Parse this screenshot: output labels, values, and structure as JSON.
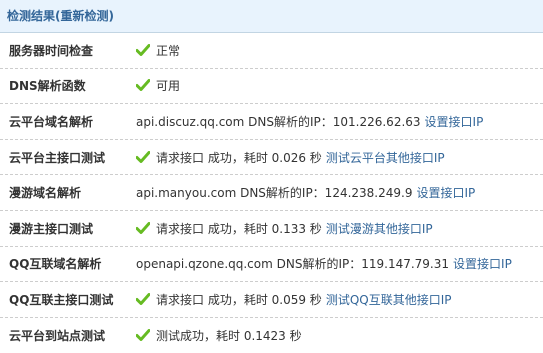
{
  "header": {
    "title": "检测结果(重新检测)"
  },
  "rows": [
    {
      "label": "服务器时间检查",
      "status": "正常"
    },
    {
      "label": "DNS解析函数",
      "status": "可用"
    },
    {
      "label": "云平台域名解析",
      "value": "api.discuz.qq.com DNS解析的IP：101.226.62.63",
      "link": "设置接口IP"
    },
    {
      "label": "云平台主接口测试",
      "status": "请求接口 成功，耗时 0.026 秒",
      "link": "测试云平台其他接口IP"
    },
    {
      "label": "漫游域名解析",
      "value": "api.manyou.com DNS解析的IP：124.238.249.9",
      "link": "设置接口IP"
    },
    {
      "label": "漫游主接口测试",
      "status": "请求接口 成功，耗时 0.133 秒",
      "link": "测试漫游其他接口IP"
    },
    {
      "label": "QQ互联域名解析",
      "value": "openapi.qzone.qq.com DNS解析的IP：119.147.79.31",
      "link": "设置接口IP"
    },
    {
      "label": "QQ互联主接口测试",
      "status": "请求接口 成功，耗时 0.059 秒",
      "link": "测试QQ互联其他接口IP"
    },
    {
      "label": "云平台到站点测试",
      "status": "测试成功，耗时 0.1423 秒"
    }
  ],
  "icons": {
    "success": "check-icon"
  },
  "colors": {
    "header_bg": "#e8f3fd",
    "link": "#336699",
    "check": "#66bb22"
  }
}
